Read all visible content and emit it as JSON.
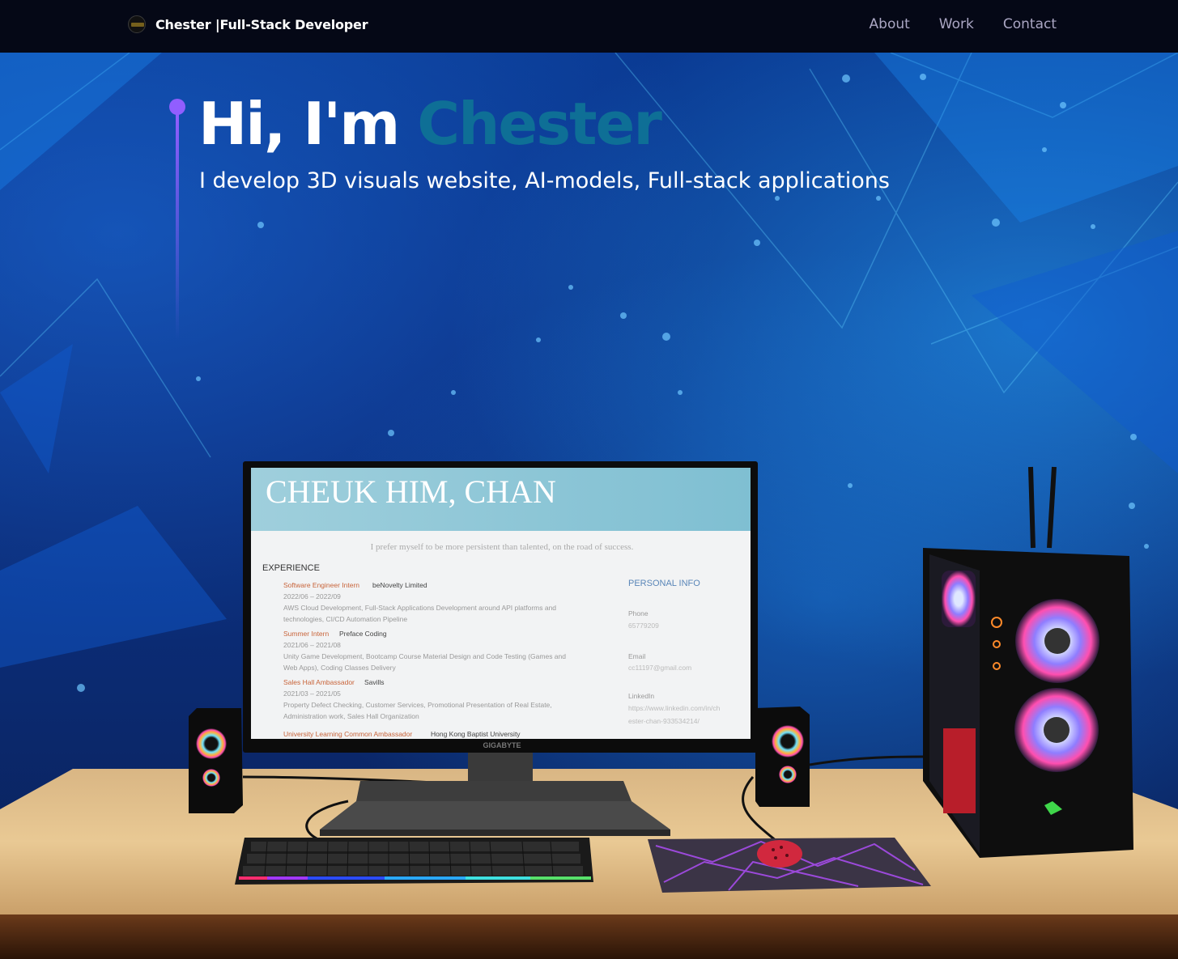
{
  "nav": {
    "brand_name": "Chester",
    "brand_role": "|Full-Stack Developer",
    "links": [
      {
        "label": "About"
      },
      {
        "label": "Work"
      },
      {
        "label": "Contact"
      }
    ]
  },
  "hero": {
    "greeting": "Hi, I'm",
    "name": "Chester",
    "subtitle": "I develop 3D visuals website, AI-models, Full-stack applications"
  },
  "monitor_screen": {
    "resume_name": "CHEUK HIM, CHAN",
    "motto": "I prefer myself to be more persistent than talented, on the road of success.",
    "experience_heading": "EXPERIENCE",
    "experience": [
      {
        "role": "Software Engineer Intern",
        "company": "beNovelty Limited",
        "dates": "2022/06 – 2022/09",
        "desc1": "AWS Cloud Development, Full-Stack Applications Development around API platforms and",
        "desc2": "technologies, CI/CD Automation Pipeline"
      },
      {
        "role": "Summer Intern",
        "company": "Preface Coding",
        "dates": "2021/06 – 2021/08",
        "desc1": "Unity Game Development, Bootcamp Course Material Design and Code Testing (Games and",
        "desc2": "Web Apps), Coding Classes Delivery"
      },
      {
        "role": "Sales Hall Ambassador",
        "company": "Savills",
        "dates": "2021/03 – 2021/05",
        "desc1": "Property Defect Checking, Customer Services, Promotional Presentation of Real Estate,",
        "desc2": "Administration work, Sales Hall Organization"
      },
      {
        "role": "University Learning Common Ambassador",
        "company": "Hong Kong Baptist University",
        "dates": "",
        "desc1": "",
        "desc2": ""
      }
    ],
    "personal_info_heading": "PERSONAL INFO",
    "phone_label": "Phone",
    "phone": "65779209",
    "email_label": "Email",
    "email": "cc11197@gmail.com",
    "linkedin_label": "LinkedIn",
    "linkedin1": "https://www.linkedin.com/in/ch",
    "linkedin2": "ester-chan-933534214/",
    "monitor_brand": "GIGABYTE"
  },
  "colors": {
    "accent_purple": "#915eff",
    "name_teal": "#0e6f96",
    "nav_bg": "#050816",
    "nav_link": "#aaa6c3"
  }
}
